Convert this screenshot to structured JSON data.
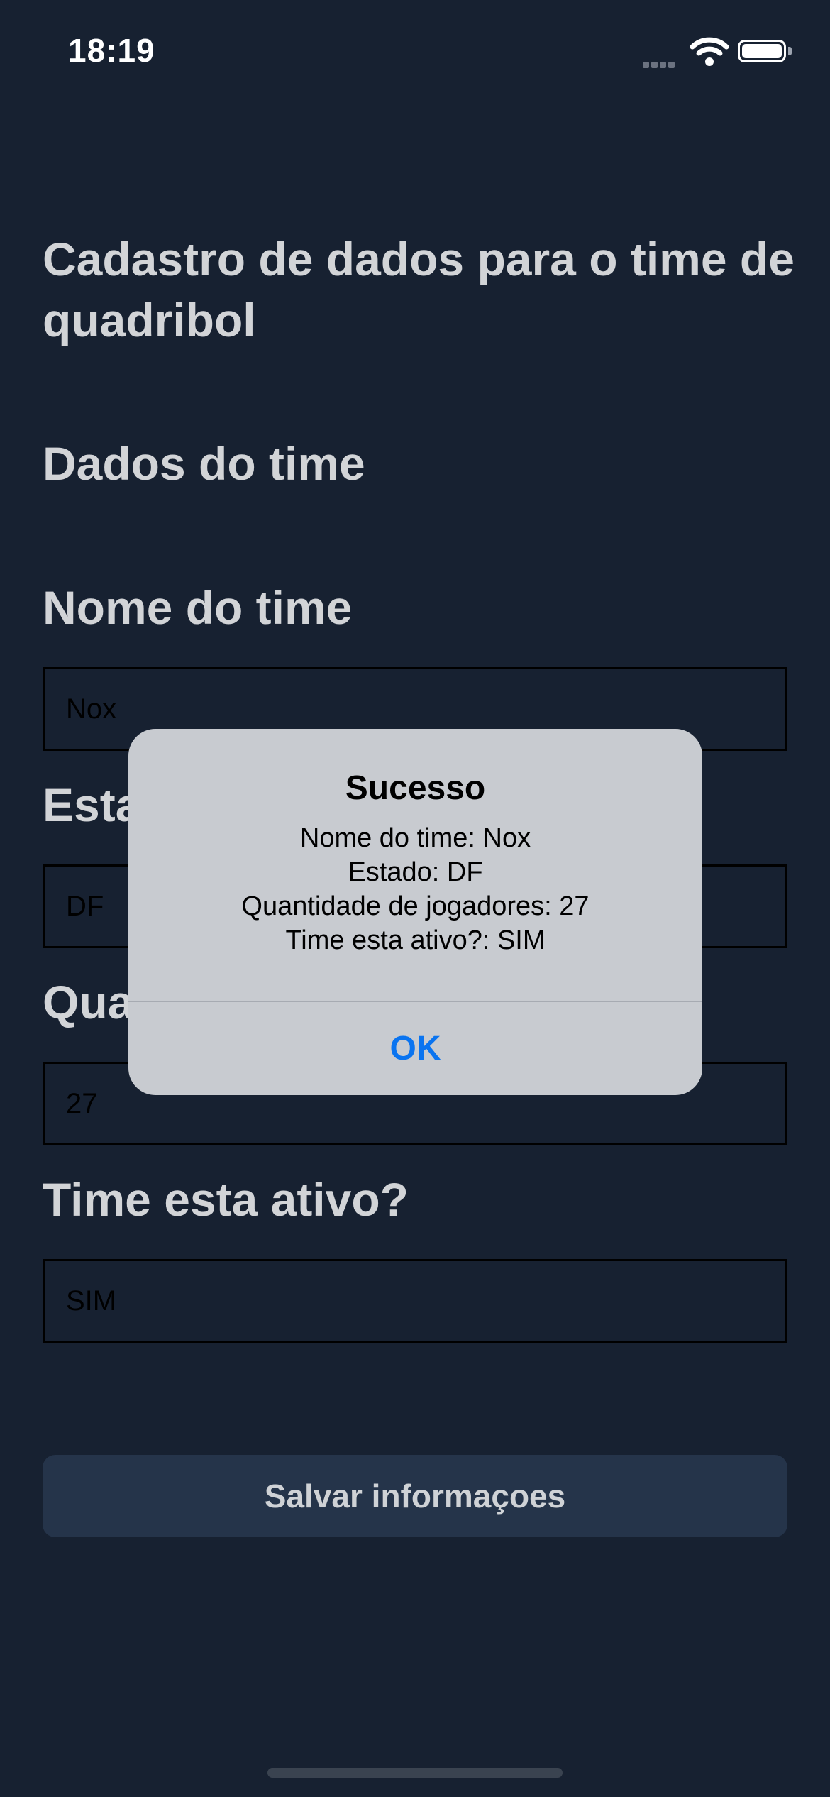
{
  "status_bar": {
    "time": "18:19"
  },
  "screen": {
    "title": "Cadastro de dados para o time de quadribol",
    "section_heading": "Dados do time",
    "fields": [
      {
        "label": "Nome do time",
        "value": "Nox"
      },
      {
        "label": "Estado",
        "value": "DF"
      },
      {
        "label": "Quantidade de jogadores",
        "value": "27"
      },
      {
        "label": "Time esta ativo?",
        "value": "SIM"
      }
    ],
    "save_button": "Salvar informaçoes"
  },
  "alert": {
    "title": "Sucesso",
    "lines": [
      "Nome do time: Nox",
      "Estado: DF",
      "Quantidade de jogadores: 27",
      "Time esta ativo?: SIM"
    ],
    "ok_label": "OK"
  },
  "colors": {
    "background": "#172131",
    "text": "#d2d4d7",
    "button_bg": "#25344a",
    "alert_bg": "#c8cbd0",
    "accent": "#0a74f0"
  }
}
